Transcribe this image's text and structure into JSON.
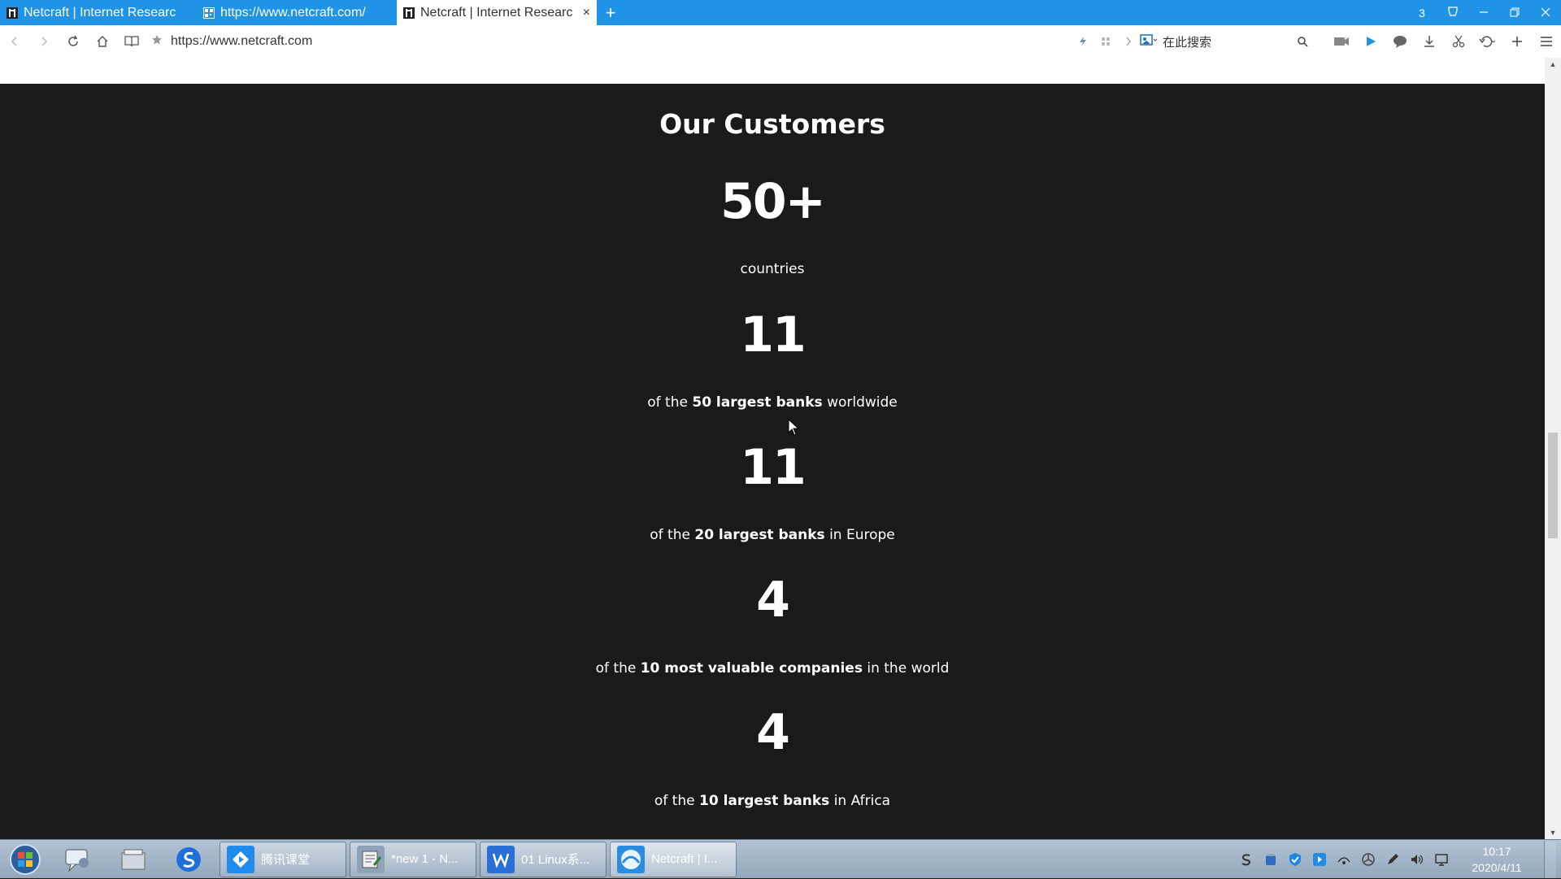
{
  "browser": {
    "tabs": [
      {
        "label": "Netcraft | Internet Researc",
        "favicon": "netcraft-logo",
        "active": false
      },
      {
        "label": "https://www.netcraft.com/",
        "favicon": "qr-page-icon",
        "active": false
      },
      {
        "label": "Netcraft | Internet Researc",
        "favicon": "netcraft-logo",
        "active": true
      }
    ],
    "new_tab_symbol": "+",
    "tab_count_badge": "3",
    "close_tab_symbol": "×",
    "url": "https://www.netcraft.com",
    "search_placeholder": "在此搜索",
    "accent_color": "#1f93e5"
  },
  "page": {
    "section_title": "Our Customers",
    "stats": [
      {
        "value": "50+",
        "prefix": "",
        "bold": "",
        "suffix": "countries"
      },
      {
        "value": "11",
        "prefix": "of the",
        "bold": "50 largest banks",
        "suffix": "worldwide"
      },
      {
        "value": "11",
        "prefix": "of the",
        "bold": "20 largest banks",
        "suffix": "in Europe"
      },
      {
        "value": "4",
        "prefix": "of the",
        "bold": "10 most valuable companies",
        "suffix": "in the world"
      },
      {
        "value": "4",
        "prefix": "of the",
        "bold": "10 largest banks",
        "suffix": "in Africa"
      }
    ],
    "background_color": "#1a1a1a"
  },
  "taskbar": {
    "buttons": [
      {
        "label": "腾讯课堂",
        "icon": "tencent-classroom-icon",
        "active": false
      },
      {
        "label": "*new 1 - N...",
        "icon": "notepad-plus-icon",
        "active": false
      },
      {
        "label": "01 Linux系...",
        "icon": "wps-writer-icon",
        "active": false
      },
      {
        "label": "Netcraft | I...",
        "icon": "browser-icon",
        "active": true
      }
    ],
    "clock_time": "10:17",
    "clock_date": "2020/4/11"
  }
}
